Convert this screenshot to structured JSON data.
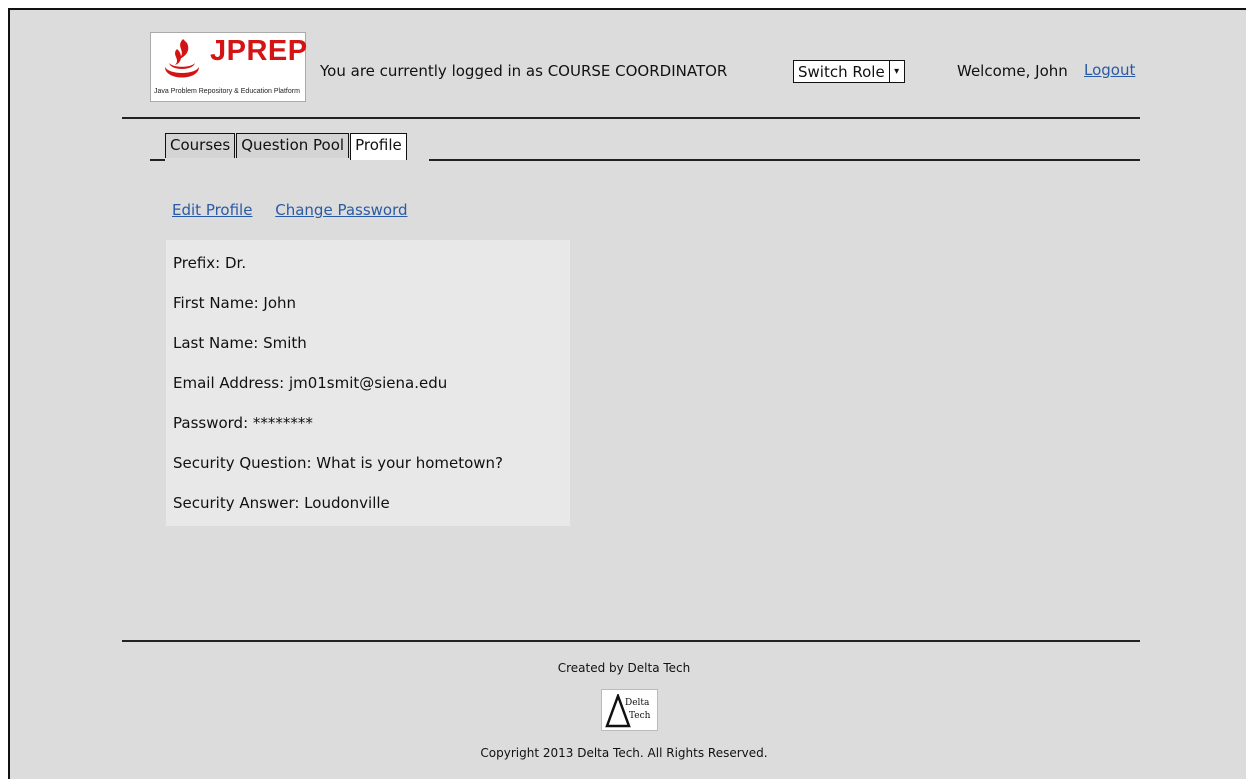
{
  "header": {
    "logo": {
      "brand": "JPREP",
      "tagline": "Java Problem Repository & Education Platform"
    },
    "role_text": "You are currently logged in as COURSE COORDINATOR",
    "switch_role": {
      "label": "Switch Role",
      "arrow": "▾"
    },
    "welcome": "Welcome, John",
    "logout": "Logout"
  },
  "tabs": [
    {
      "label": "Courses",
      "active": false
    },
    {
      "label": "Question Pool",
      "active": false
    },
    {
      "label": "Profile",
      "active": true
    }
  ],
  "actions": {
    "edit_profile": "Edit Profile",
    "change_password": "Change Password"
  },
  "profile": [
    "Prefix: Dr.",
    "First Name: John",
    "Last Name: Smith",
    "Email Address: jm01smit@siena.edu",
    "Password: ********",
    "Security Question: What is your hometown?",
    "Security Answer: Loudonville"
  ],
  "footer": {
    "created_by": "Created by Delta Tech",
    "logo": {
      "line1": "Delta",
      "line2": "Tech"
    },
    "copyright": "Copyright 2013 Delta Tech. All Rights Reserved."
  },
  "colors": {
    "link": "#2a5aa5",
    "brand": "#d41414",
    "background": "#dcdcdc",
    "panel": "#e8e8e8"
  }
}
